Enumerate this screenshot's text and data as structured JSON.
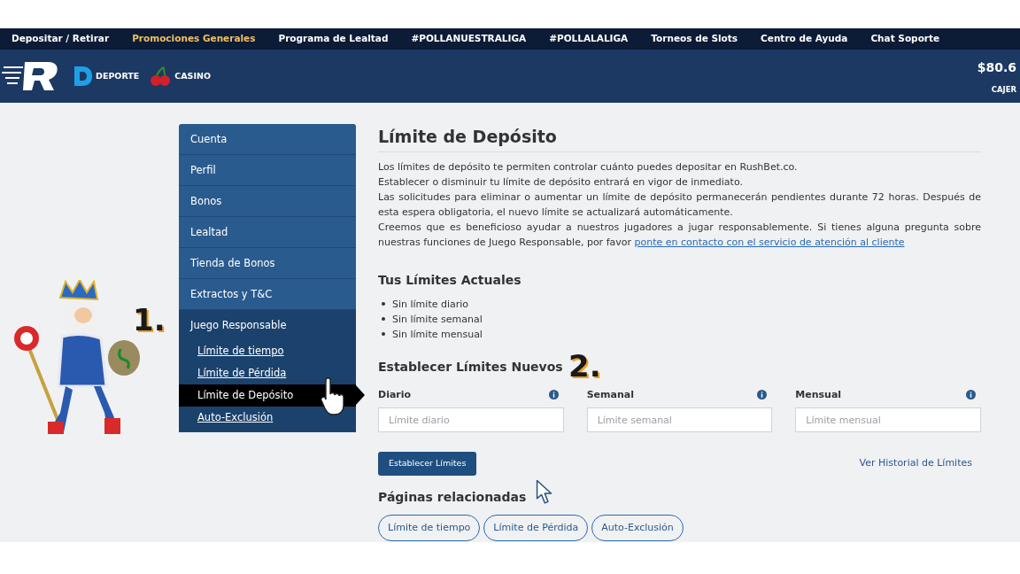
{
  "top_nav": [
    {
      "label": "Depositar / Retirar",
      "selected": false
    },
    {
      "label": "Promociones Generales",
      "selected": true
    },
    {
      "label": "Programa de Lealtad",
      "selected": false
    },
    {
      "label": "#POLLANUESTRALIGA",
      "selected": false
    },
    {
      "label": "#POLLALALIGA",
      "selected": false
    },
    {
      "label": "Torneos de Slots",
      "selected": false
    },
    {
      "label": "Centro de Ayuda",
      "selected": false
    },
    {
      "label": "Chat Soporte",
      "selected": false
    }
  ],
  "header": {
    "products": [
      {
        "kind": "sport",
        "label": "DEPORTE"
      },
      {
        "kind": "casino",
        "label": "CASINO"
      }
    ],
    "balance": "$80.6",
    "cashier": "CAJER"
  },
  "sidebar": {
    "items": [
      {
        "label": "Cuenta",
        "selected": false
      },
      {
        "label": "Perfil",
        "selected": false
      },
      {
        "label": "Bonos",
        "selected": false
      },
      {
        "label": "Lealtad",
        "selected": false
      },
      {
        "label": "Tienda de Bonos",
        "selected": false
      },
      {
        "label": "Extractos y T&C",
        "selected": false
      },
      {
        "label": "Juego Responsable",
        "selected": false,
        "expanded": true,
        "children": [
          {
            "label": "Límite de tiempo",
            "selected": false
          },
          {
            "label": "Límite de Pérdida",
            "selected": false
          },
          {
            "label": "Límite de Depósito",
            "selected": true
          },
          {
            "label": "Auto-Exclusión",
            "selected": false
          }
        ]
      }
    ]
  },
  "annotations": {
    "step_one": "1.",
    "step_two": "2."
  },
  "main": {
    "title": "Límite de Depósito",
    "paragraphs": [
      "Los límites de depósito te permiten controlar cuánto puedes depositar en RushBet.co.",
      "Establecer o disminuir tu límite de depósito entrará en vigor de inmediato.",
      "Las solicitudes para eliminar o aumentar un límite de depósito permanecerán pendientes durante 72 horas. Después de esta espera obligatoria, el nuevo límite se actualizará automáticamente."
    ],
    "last_paragraph": "Creemos que es beneficioso ayudar a nuestros jugadores a jugar responsablemente. Si tienes alguna pregunta sobre nuestras funciones de Juego Responsable, por favor",
    "contact_link": "ponte en contacto con el servicio de atención al cliente",
    "current_title": "Tus Límites Actuales",
    "current_limits": [
      "Sin límite diario",
      "Sin límite semanal",
      "Sin límite mensual"
    ],
    "new_title": "Establecer Límites Nuevos",
    "fields": [
      {
        "label": "Diario",
        "placeholder": "Límite diario"
      },
      {
        "label": "Semanal",
        "placeholder": "Límite semanal"
      },
      {
        "label": "Mensual",
        "placeholder": "Límite mensual"
      }
    ],
    "submit": "Establecer Límites",
    "history_link": "Ver Historial de Límites",
    "related_title": "Páginas relacionadas",
    "related": [
      "Límite de tiempo",
      "Límite de Pérdida",
      "Auto-Exclusión"
    ]
  }
}
